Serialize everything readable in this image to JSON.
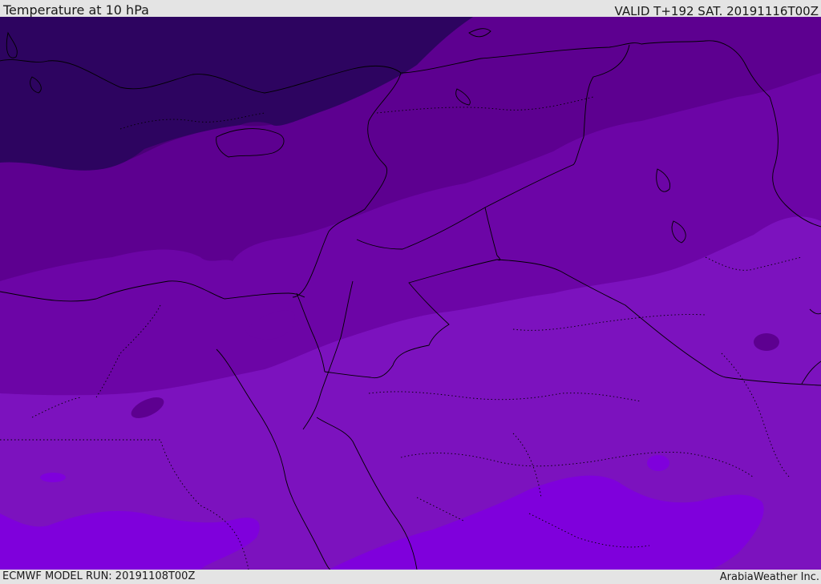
{
  "header": {
    "title": "Temperature at 10 hPa",
    "valid_time": "VALID T+192 SAT. 20191116T00Z"
  },
  "footer": {
    "model_run": "ECMWF MODEL RUN: 20191108T00Z",
    "credit": "ArabiaWeather Inc."
  },
  "map": {
    "temperature_bands": [
      {
        "name": "coldest-band",
        "color": "#2d0460"
      },
      {
        "name": "cold-band",
        "color": "#4a0078"
      },
      {
        "name": "cool-band",
        "color": "#5d0090"
      },
      {
        "name": "mild-band",
        "color": "#6c05a6"
      },
      {
        "name": "warm-band",
        "color": "#7c12be"
      },
      {
        "name": "warmest-band",
        "color": "#7f00dc"
      }
    ],
    "border_color": "#000000"
  }
}
